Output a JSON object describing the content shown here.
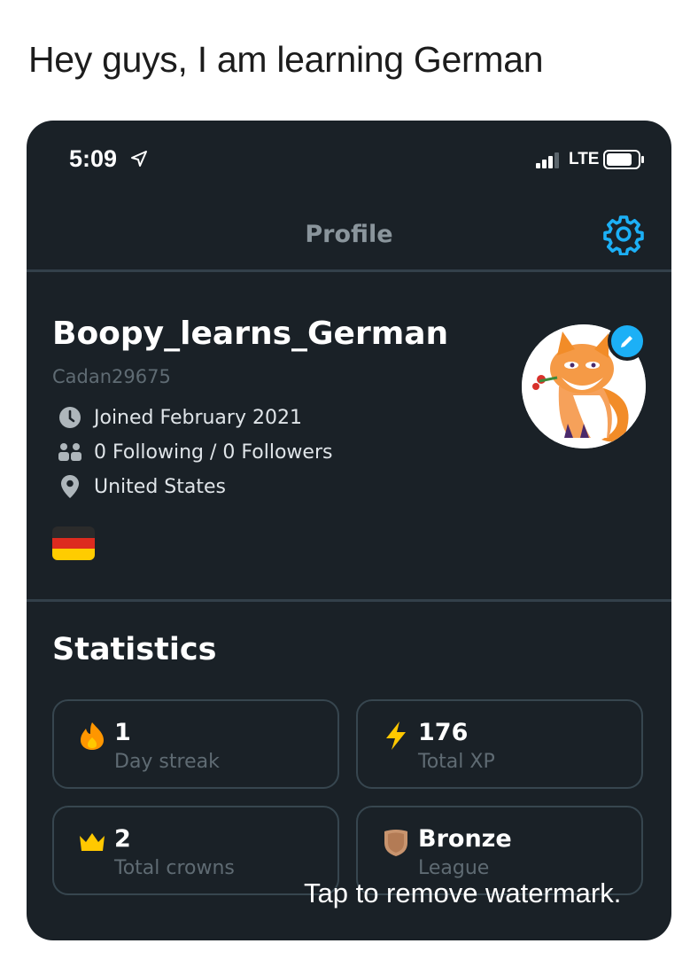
{
  "caption": "Hey guys, I am learning German",
  "status_bar": {
    "time": "5:09",
    "network": "LTE"
  },
  "header": {
    "title": "Profile",
    "settings_icon": "gear-icon"
  },
  "profile": {
    "display_name": "Boopy_learns_German",
    "username": "Cadan29675",
    "joined": "Joined February 2021",
    "follows": "0 Following / 0 Followers",
    "location": "United States",
    "course_flag": "german-flag"
  },
  "statistics": {
    "title": "Statistics",
    "cards": [
      {
        "value": "1",
        "label": "Day streak",
        "icon": "flame-icon"
      },
      {
        "value": "176",
        "label": "Total XP",
        "icon": "lightning-icon"
      },
      {
        "value": "2",
        "label": "Total crowns",
        "icon": "crown-icon"
      },
      {
        "value": "Bronze",
        "label": "League",
        "icon": "bronze-shield-icon"
      }
    ]
  },
  "watermark": "Tap to remove watermark.",
  "colors": {
    "background": "#1a2127",
    "accent": "#1cb0f6",
    "divider": "#33404a",
    "muted_text": "#5f6b73",
    "flame": "#ff9600",
    "xp": "#ffc800",
    "bronze": "#c8946e"
  }
}
